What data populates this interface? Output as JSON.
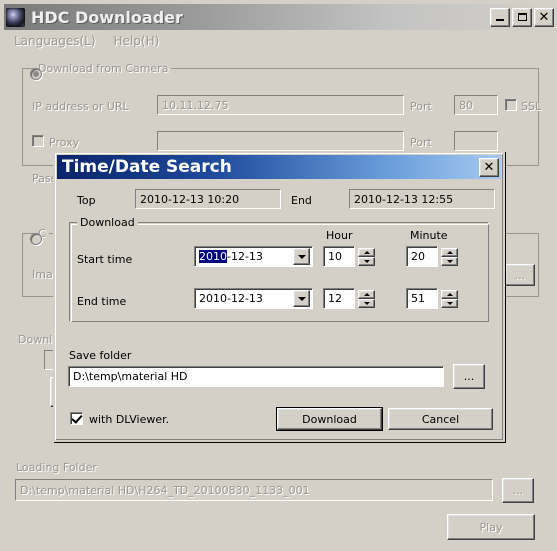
{
  "window": {
    "title": "HDC Downloader",
    "icon": "camera-lens-icon",
    "buttons": {
      "minimize": "_",
      "maximize": "□",
      "close": "✕"
    }
  },
  "menubar": {
    "items": [
      {
        "label": "Languages(L)"
      },
      {
        "label": "Help(H)"
      }
    ]
  },
  "background": {
    "camera_group": {
      "legend": "Download from Camera",
      "radio_selected": true,
      "ip_label": "IP address or URL",
      "ip_value": "10.11.12.75",
      "port_label": "Port",
      "port_value": "80",
      "ssl_label": "SSL",
      "ssl_checked": false,
      "proxy_label": "Proxy",
      "proxy_checked": false,
      "proxy_value": "",
      "proxy_port_label": "Port",
      "proxy_port_value": "",
      "password_label": "Pass"
    },
    "file_group": {
      "legend": "C",
      "radio_selected": false,
      "image_label": "Ima",
      "browse_label": "..."
    },
    "download_label": "Downlo",
    "loading_folder": {
      "label": "Loading Folder",
      "value": "D:\\temp\\material HD\\H264_TD_20100830_1133_001",
      "browse_label": "...",
      "play_label": "Play"
    }
  },
  "dialog": {
    "title": "Time/Date Search",
    "close_label": "✕",
    "top_label": "Top",
    "top_value": "2010-12-13 10:20",
    "end_label": "End",
    "end_value": "2010-12-13 12:55",
    "download_group": {
      "legend": "Download",
      "hour_header": "Hour",
      "minute_header": "Minute",
      "start": {
        "label": "Start time",
        "date_selected_part": "2010",
        "date_rest": "-12-13",
        "hour": "10",
        "minute": "20"
      },
      "end": {
        "label": "End time",
        "date": "2010-12-13",
        "hour": "12",
        "minute": "51"
      }
    },
    "save_folder": {
      "label": "Save folder",
      "value": "D:\\temp\\material HD",
      "browse_label": "..."
    },
    "dlviewer": {
      "label": "with DLViewer.",
      "checked": true
    },
    "download_button": "Download",
    "cancel_button": "Cancel"
  },
  "colors": {
    "face": "#d4d0c8",
    "dialog_title_start": "#0a246a",
    "dialog_title_end": "#a6caf0",
    "selection": "#000080",
    "disabled_text": "#9b9690"
  }
}
